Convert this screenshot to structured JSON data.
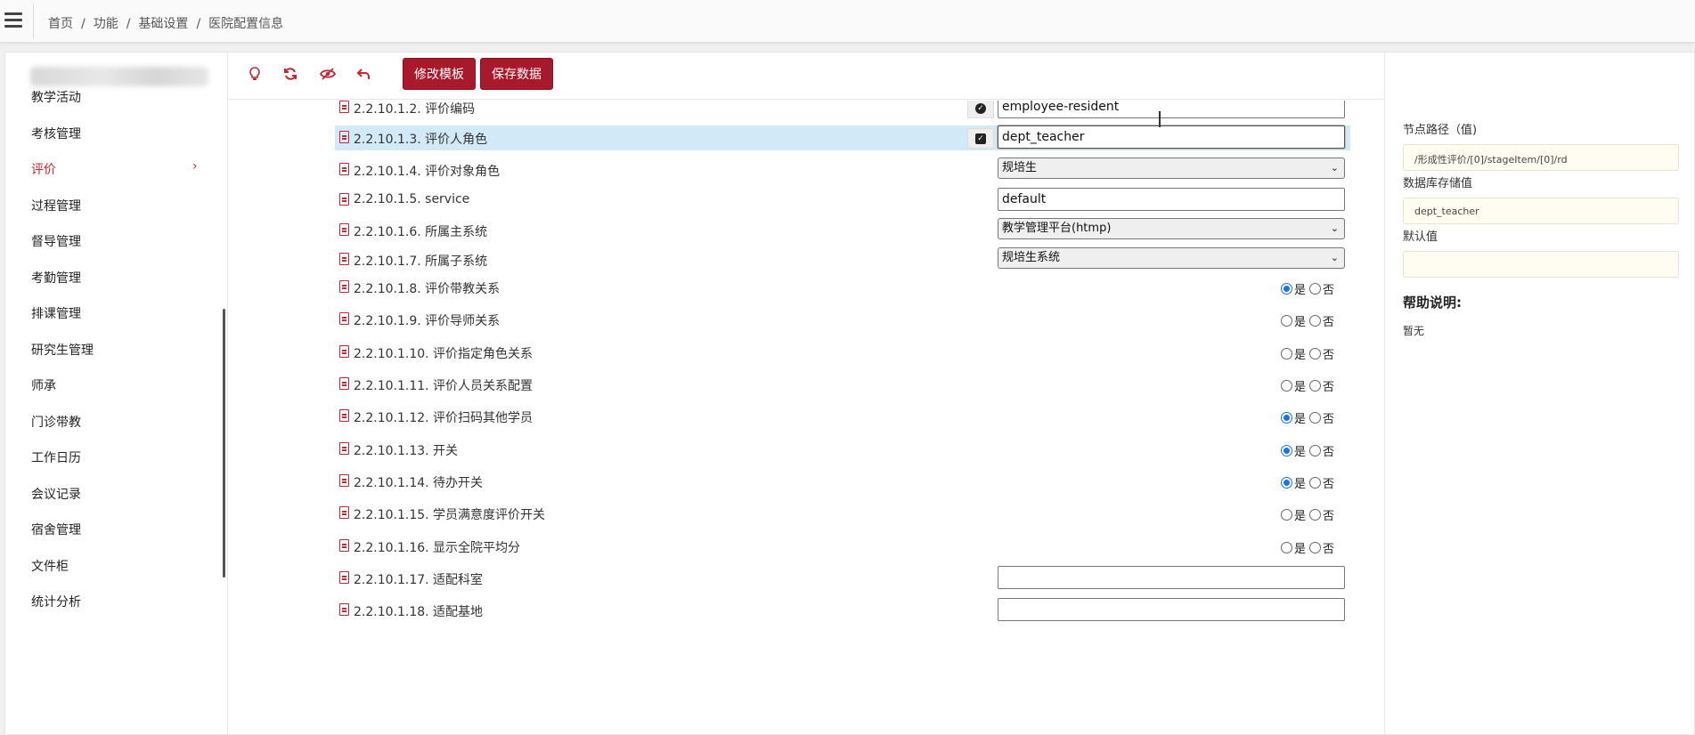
{
  "breadcrumb": [
    "首页",
    "功能",
    "基础设置",
    "医院配置信息"
  ],
  "sidebar": {
    "items": [
      {
        "label": "教学活动"
      },
      {
        "label": "考核管理"
      },
      {
        "label": "评价",
        "active": true
      },
      {
        "label": "过程管理"
      },
      {
        "label": "督导管理"
      },
      {
        "label": "考勤管理"
      },
      {
        "label": "排课管理"
      },
      {
        "label": "研究生管理"
      },
      {
        "label": "师承"
      },
      {
        "label": "门诊带教"
      },
      {
        "label": "工作日历"
      },
      {
        "label": "会议记录"
      },
      {
        "label": "宿舍管理"
      },
      {
        "label": "文件柜"
      },
      {
        "label": "统计分析"
      }
    ],
    "active_chevron": "›"
  },
  "toolbar": {
    "icons": [
      "lightbulb-icon",
      "refresh-icon",
      "hide-icon",
      "undo-icon"
    ],
    "edit_template_label": "修改模板",
    "save_data_label": "保存数据"
  },
  "rows": [
    {
      "label": "2.2.10.1.2. 评价编码",
      "type": "text",
      "value": "employee-resident",
      "check": "circle"
    },
    {
      "label": "2.2.10.1.3. 评价人角色",
      "type": "text",
      "value": "dept_teacher",
      "check": "square",
      "highlight": true
    },
    {
      "label": "2.2.10.1.4. 评价对象角色",
      "type": "select",
      "value": "规培生"
    },
    {
      "label": "2.2.10.1.5. service",
      "type": "text",
      "value": "default"
    },
    {
      "label": "2.2.10.1.6. 所属主系统",
      "type": "select",
      "value": "教学管理平台(htmp)"
    },
    {
      "label": "2.2.10.1.7. 所属子系统",
      "type": "select",
      "value": "规培生系统"
    },
    {
      "label": "2.2.10.1.8. 评价带教关系",
      "type": "radio",
      "value": "yes"
    },
    {
      "label": "2.2.10.1.9. 评价导师关系",
      "type": "radio",
      "value": "none"
    },
    {
      "label": "2.2.10.1.10. 评价指定角色关系",
      "type": "radio",
      "value": "none"
    },
    {
      "label": "2.2.10.1.11. 评价人员关系配置",
      "type": "radio",
      "value": "none"
    },
    {
      "label": "2.2.10.1.12. 评价扫码其他学员",
      "type": "radio",
      "value": "yes"
    },
    {
      "label": "2.2.10.1.13. 开关",
      "type": "radio",
      "value": "yes"
    },
    {
      "label": "2.2.10.1.14. 待办开关",
      "type": "radio",
      "value": "yes"
    },
    {
      "label": "2.2.10.1.15. 学员满意度评价开关",
      "type": "radio",
      "value": "none"
    },
    {
      "label": "2.2.10.1.16. 显示全院平均分",
      "type": "radio",
      "value": "none"
    },
    {
      "label": "2.2.10.1.17. 适配科室",
      "type": "text",
      "value": ""
    },
    {
      "label": "2.2.10.1.18. 适配基地",
      "type": "text",
      "value": ""
    }
  ],
  "radio_labels": {
    "yes": "是",
    "no": "否"
  },
  "right_panel": {
    "node_path_label": "节点路径（值)",
    "node_path_value": "/形成性评价/[0]/stageItem/[0]/rd",
    "db_value_label": "数据库存储值",
    "db_value": "dept_teacher",
    "default_label": "默认值",
    "default_value": "",
    "help_title": "帮助说明:",
    "help_text": "暂无"
  },
  "colors": {
    "accent": "#a8192b",
    "active_nav": "#c9242f",
    "highlight_row": "#d2eaf8",
    "radio_on": "#1a73e8"
  }
}
